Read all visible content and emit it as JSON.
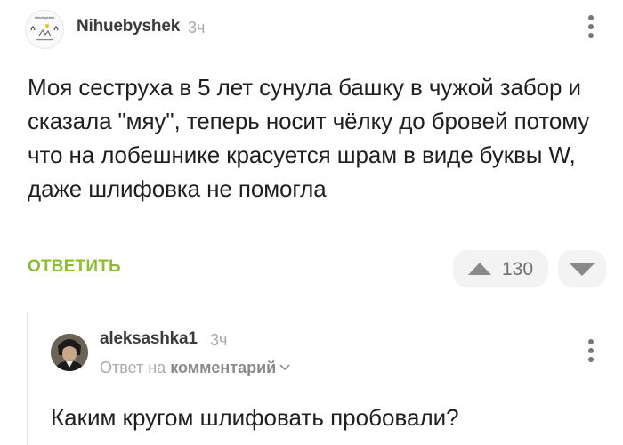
{
  "top_comment": {
    "author": "Nihuebyshek",
    "time": "3ч",
    "avatar_label": "nihuebyshek",
    "text": "Моя сеструха в 5 лет сунула башку в чужой забор и сказала \"мяу\", теперь носит чёлку до бровей потому что на лобешнике красуется шрам в виде буквы W, даже шлифовка не помогла",
    "reply_label": "ОТВЕТИТЬ",
    "rating": "130",
    "icons": {
      "more": "more-vertical-icon",
      "upvote": "triangle-up-icon",
      "downvote": "triangle-down-icon"
    }
  },
  "reply_comment": {
    "author": "aleksashka1",
    "time": "3ч",
    "reply_prefix": "Ответ на",
    "reply_link": "комментарий",
    "text": "Каким кругом шлифовать пробовали?",
    "icons": {
      "more": "more-vertical-icon",
      "expand": "chevron-down-icon"
    }
  },
  "colors": {
    "accent_green": "#8bbf2d",
    "muted_text": "#a9a9a9",
    "pill_bg": "#f3f3f3",
    "icon_gray": "#777777"
  }
}
